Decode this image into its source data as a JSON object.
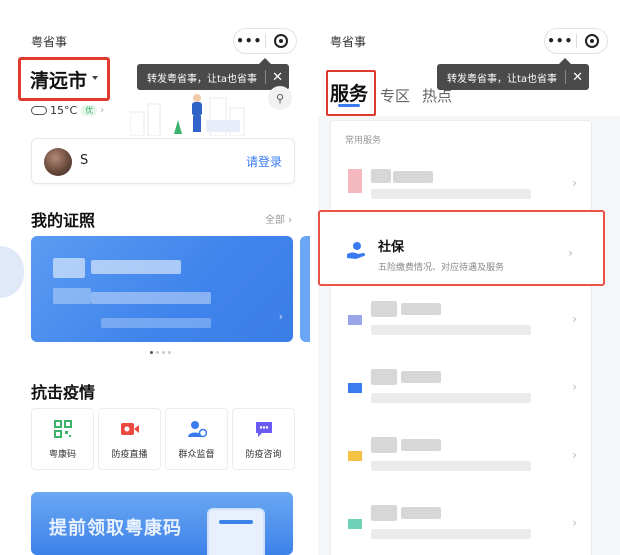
{
  "left_panel": {
    "app_title": "粤省事",
    "tooltip": {
      "text": "转发粤省事，让ta也省事",
      "close": "✕"
    },
    "location": {
      "city": "清远市"
    },
    "weather": {
      "temperature": "15°C",
      "air_quality": "优",
      "arrow": "›"
    },
    "user": {
      "name": "S",
      "login_label": "请登录"
    },
    "certificates": {
      "title": "我的证照",
      "all_label": "全部 ›",
      "arrow": "›"
    },
    "epidemic": {
      "title": "抗击疫情",
      "services": [
        {
          "label": "粤康码",
          "icon": "qr-code-icon",
          "color": "#3bb36a"
        },
        {
          "label": "防疫直播",
          "icon": "video-camera-icon",
          "color": "#e9493f"
        },
        {
          "label": "群众监督",
          "icon": "user-check-icon",
          "color": "#3a7cf0"
        },
        {
          "label": "防疫咨询",
          "icon": "chat-bubble-icon",
          "color": "#6a5cf2"
        }
      ]
    },
    "banner": {
      "text": "提前领取粤康码"
    }
  },
  "right_panel": {
    "app_title": "粤省事",
    "tooltip": {
      "text": "转发粤省事，让ta也省事",
      "close": "✕"
    },
    "tabs": [
      {
        "label": "服务",
        "active": true
      },
      {
        "label": "专区",
        "active": false
      },
      {
        "label": "热点",
        "active": false
      }
    ],
    "list_caption": "常用服务",
    "rows": [
      {
        "title": "",
        "accent": "#f4b8bf",
        "chevron": "›"
      },
      {
        "title": "社保",
        "description": "五险缴费情况、对应待遇及服务",
        "icon": "social-security-hand-icon",
        "accent": "#3a7cf0",
        "chevron": "›",
        "highlighted": true
      },
      {
        "title": "",
        "accent": "#9aa6e8",
        "chevron": "›"
      },
      {
        "title": "",
        "accent": "#3a7cf0",
        "chevron": "›"
      },
      {
        "title": "",
        "accent": "#f5c343",
        "chevron": "›"
      },
      {
        "title": "",
        "accent": "#6fd1b5",
        "chevron": "›"
      }
    ]
  },
  "colors": {
    "accent_blue": "#3a7cf0",
    "highlight_red": "#e03a2f",
    "card_blue": "#4a8cef"
  }
}
